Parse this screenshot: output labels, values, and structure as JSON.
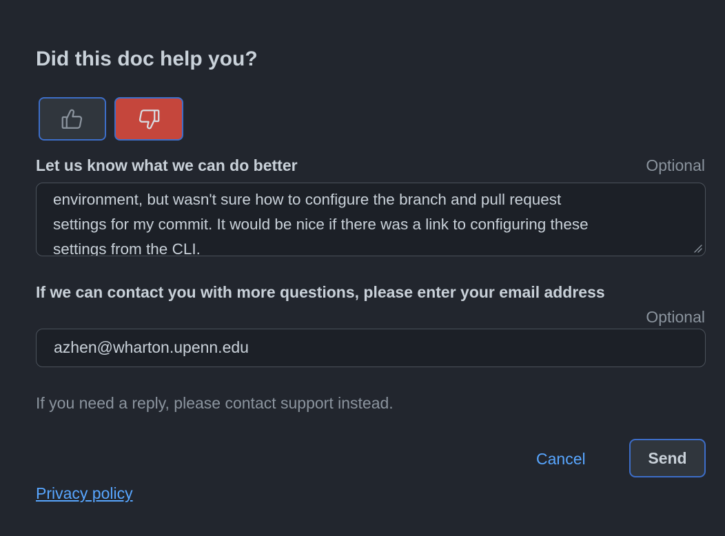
{
  "feedback": {
    "title": "Did this doc help you?",
    "vote": {
      "up_icon": "thumbs-up-icon",
      "down_icon": "thumbs-down-icon",
      "selected": "down"
    },
    "improve_label": "Let us know what we can do better",
    "improve_optional": "Optional",
    "improve_lines": [
      "environment, but wasn't sure how to configure the branch and pull request",
      "settings for my commit. It would be nice if there was a link to configuring these",
      "settings from the CLI."
    ],
    "email_label": "If we can contact you with more questions, please enter your email address",
    "email_optional": "Optional",
    "email_value": "azhen@wharton.upenn.edu",
    "hint": "If you need a reply, please contact support instead.",
    "cancel_label": "Cancel",
    "send_label": "Send",
    "privacy_label": "Privacy policy"
  },
  "colors": {
    "background": "#22262e",
    "accent_border": "#3d6ec9",
    "selected_down": "#c5463c",
    "link": "#58a6ff"
  }
}
